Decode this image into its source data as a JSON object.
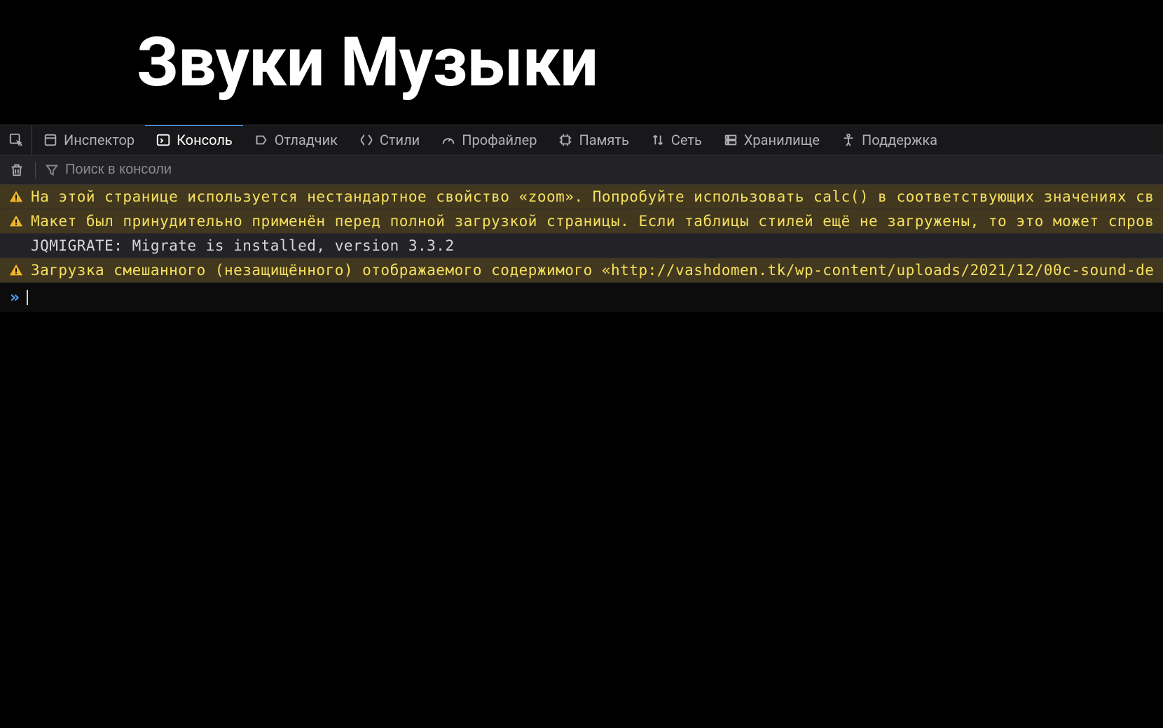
{
  "page": {
    "title": "Звуки Музыки"
  },
  "tabs": {
    "items": [
      {
        "label": "Инспектор",
        "icon": "inspector"
      },
      {
        "label": "Консоль",
        "icon": "console",
        "active": true
      },
      {
        "label": "Отладчик",
        "icon": "debugger"
      },
      {
        "label": "Стили",
        "icon": "styles"
      },
      {
        "label": "Профайлер",
        "icon": "profiler"
      },
      {
        "label": "Память",
        "icon": "memory"
      },
      {
        "label": "Сеть",
        "icon": "network"
      },
      {
        "label": "Хранилище",
        "icon": "storage"
      },
      {
        "label": "Поддержка",
        "icon": "accessibility"
      }
    ]
  },
  "toolbar": {
    "search_placeholder": "Поиск в консоли"
  },
  "console": {
    "messages": [
      {
        "type": "warning",
        "text": "На этой странице используется нестандартное свойство «zoom». Попробуйте использовать calc() в соответствующих значениях св"
      },
      {
        "type": "warning",
        "text": "Макет был принудительно применён перед полной загрузкой страницы. Если таблицы стилей ещё не загружены, то это может спров"
      },
      {
        "type": "log",
        "text": "JQMIGRATE: Migrate is installed, version 3.3.2"
      },
      {
        "type": "warning",
        "text": "Загрузка смешанного (незащищённого) отображаемого содержимого «http://vashdomen.tk/wp-content/uploads/2021/12/00c-sound-de"
      }
    ],
    "prompt": "»"
  }
}
